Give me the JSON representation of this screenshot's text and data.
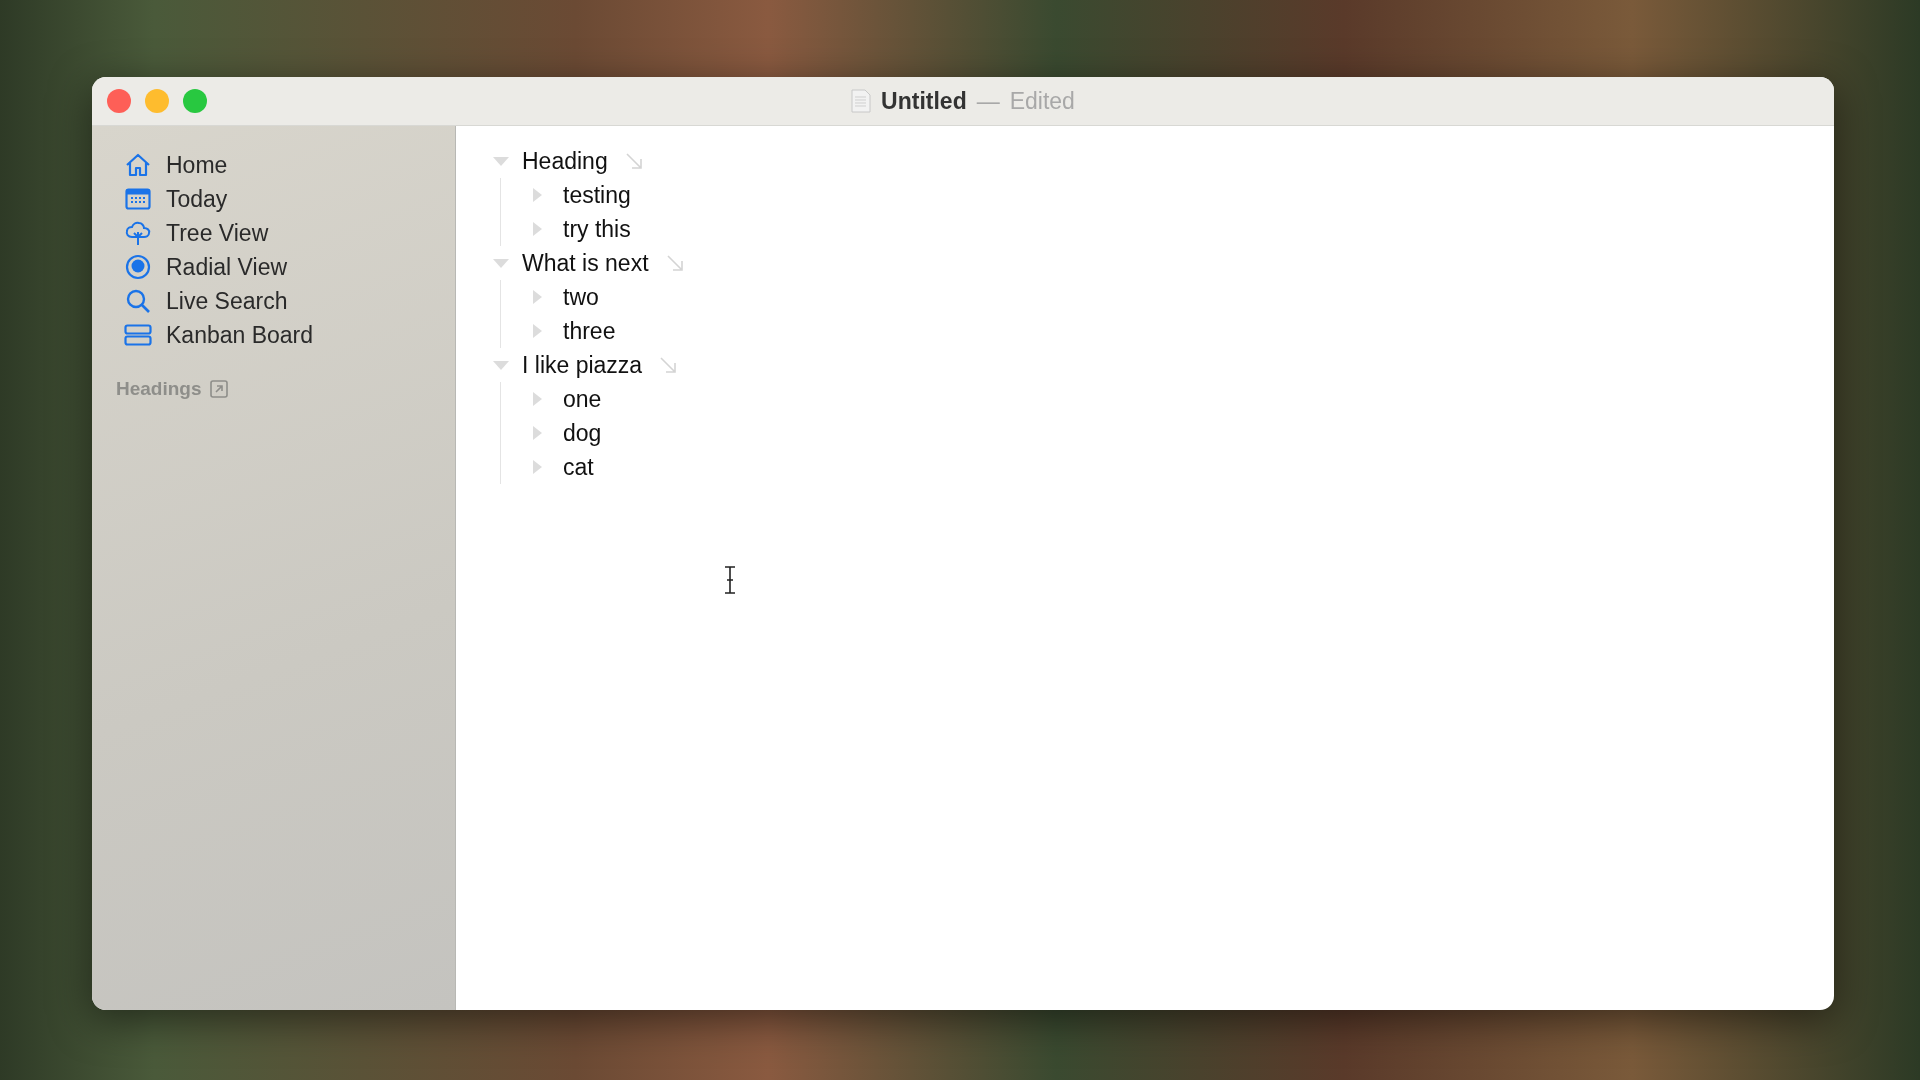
{
  "window": {
    "title": "Untitled",
    "separator": "—",
    "status": "Edited"
  },
  "sidebar": {
    "items": [
      {
        "label": "Home",
        "selected": false
      },
      {
        "label": "Today",
        "selected": false
      },
      {
        "label": "Tree View",
        "selected": false
      },
      {
        "label": "Radial View",
        "selected": false
      },
      {
        "label": "Live Search",
        "selected": false
      },
      {
        "label": "Kanban Board",
        "selected": false
      }
    ],
    "section": "Headings"
  },
  "outline": [
    {
      "text": "Heading",
      "expanded": true,
      "children": [
        {
          "text": "testing",
          "expanded": false
        },
        {
          "text": "try this",
          "expanded": false
        }
      ]
    },
    {
      "text": "What is next",
      "expanded": true,
      "children": [
        {
          "text": "two",
          "expanded": false
        },
        {
          "text": "three",
          "expanded": false
        }
      ]
    },
    {
      "text": "I like piazza",
      "expanded": true,
      "children": [
        {
          "text": "one",
          "expanded": false
        },
        {
          "text": "dog",
          "expanded": false
        },
        {
          "text": "cat",
          "expanded": false
        }
      ]
    }
  ]
}
